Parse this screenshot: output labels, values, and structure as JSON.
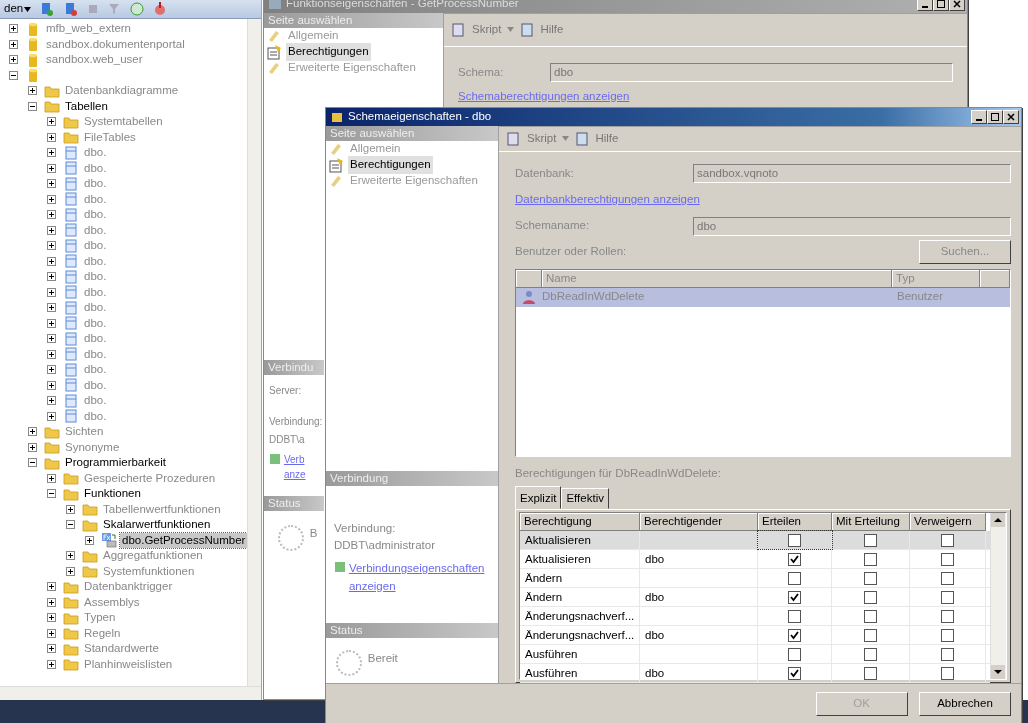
{
  "explorer": {
    "toolbar_label": "den",
    "tree": [
      {
        "kind": "database",
        "label": "mfb_web_extern",
        "expanded": false,
        "selected": false
      },
      {
        "kind": "database",
        "label": "sandbox.dokumentenportal",
        "expanded": false,
        "selected": false
      },
      {
        "kind": "database",
        "label": "sandbox.web_user",
        "expanded": false,
        "selected": false
      },
      {
        "kind": "database",
        "expanded": true,
        "selected": false,
        "children": [
          {
            "kind": "folder",
            "label": "Datenbankdiagramme",
            "expanded": false,
            "selected": false
          },
          {
            "kind": "folder",
            "label": "Tabellen",
            "expanded": true,
            "selected": false,
            "children": [
              {
                "kind": "folder",
                "label": "Systemtabellen",
                "expanded": false,
                "selected": false
              },
              {
                "kind": "folder",
                "label": "FileTables",
                "expanded": false,
                "selected": false
              },
              {
                "kind": "table",
                "label": "dbo.",
                "expanded": false,
                "selected": false
              },
              {
                "kind": "table",
                "label": "dbo.",
                "expanded": false,
                "selected": false
              },
              {
                "kind": "table",
                "label": "dbo.",
                "expanded": false,
                "selected": false
              },
              {
                "kind": "table",
                "label": "dbo.",
                "expanded": false,
                "selected": false
              },
              {
                "kind": "table",
                "label": "dbo.",
                "expanded": false,
                "selected": false
              },
              {
                "kind": "table",
                "label": "dbo.",
                "expanded": false,
                "selected": false
              },
              {
                "kind": "table",
                "label": "dbo.",
                "expanded": false,
                "selected": false
              },
              {
                "kind": "table",
                "label": "dbo.",
                "expanded": false,
                "selected": false
              },
              {
                "kind": "table",
                "label": "dbo.",
                "expanded": false,
                "selected": false
              },
              {
                "kind": "table",
                "label": "dbo.",
                "expanded": false,
                "selected": false
              },
              {
                "kind": "table",
                "label": "dbo.",
                "expanded": false,
                "selected": false
              },
              {
                "kind": "table",
                "label": "dbo.",
                "expanded": false,
                "selected": false
              },
              {
                "kind": "table",
                "label": "dbo.",
                "expanded": false,
                "selected": false
              },
              {
                "kind": "table",
                "label": "dbo.",
                "expanded": false,
                "selected": false
              },
              {
                "kind": "table",
                "label": "dbo.",
                "expanded": false,
                "selected": false
              },
              {
                "kind": "table",
                "label": "dbo.",
                "expanded": false,
                "selected": false
              },
              {
                "kind": "table",
                "label": "dbo.",
                "expanded": false,
                "selected": false
              },
              {
                "kind": "table",
                "label": "dbo.",
                "expanded": false,
                "selected": false
              }
            ]
          },
          {
            "kind": "folder",
            "label": "Sichten",
            "expanded": false,
            "selected": false
          },
          {
            "kind": "folder",
            "label": "Synonyme",
            "expanded": false,
            "selected": false
          },
          {
            "kind": "folder",
            "label": "Programmierbarkeit",
            "expanded": true,
            "selected": false,
            "children": [
              {
                "kind": "folder",
                "label": "Gespeicherte Prozeduren",
                "expanded": false,
                "selected": false
              },
              {
                "kind": "folder",
                "label": "Funktionen",
                "expanded": true,
                "selected": false,
                "children": [
                  {
                    "kind": "folder",
                    "label": "Tabellenwertfunktionen",
                    "expanded": false,
                    "selected": false
                  },
                  {
                    "kind": "folder",
                    "label": "Skalarwertfunktionen",
                    "expanded": true,
                    "selected": false,
                    "children": [
                      {
                        "kind": "function",
                        "label": "dbo.GetProcessNumber",
                        "expanded": false,
                        "selected": true
                      }
                    ]
                  },
                  {
                    "kind": "folder",
                    "label": "Aggregatfunktionen",
                    "expanded": false,
                    "selected": false
                  },
                  {
                    "kind": "folder",
                    "label": "Systemfunktionen",
                    "expanded": false,
                    "selected": false
                  }
                ]
              },
              {
                "kind": "folder",
                "label": "Datenbanktrigger",
                "expanded": false,
                "selected": false
              },
              {
                "kind": "folder",
                "label": "Assemblys",
                "expanded": false,
                "selected": false
              },
              {
                "kind": "folder",
                "label": "Typen",
                "expanded": false,
                "selected": false
              },
              {
                "kind": "folder",
                "label": "Regeln",
                "expanded": false,
                "selected": false
              },
              {
                "kind": "folder",
                "label": "Standardwerte",
                "expanded": false,
                "selected": false
              },
              {
                "kind": "folder",
                "label": "Planhinweislisten",
                "expanded": false,
                "selected": false
              }
            ]
          }
        ]
      }
    ]
  },
  "back_dialog": {
    "title": "Funktionseigenschaften - GetProcessNumber",
    "pages_header": "Seite auswählen",
    "pages": [
      {
        "label": "Allgemein",
        "selected": false
      },
      {
        "label": "Berechtigungen",
        "selected": true
      },
      {
        "label": "Erweiterte Eigenschaften",
        "selected": false
      }
    ],
    "script": "Skript",
    "help": "Hilfe",
    "schema_label": "Schema:",
    "schema_value": "dbo",
    "schema_link": "Schemaberechtigungen anzeigen",
    "connection_header": "Verbindu",
    "server_label": "Server:",
    "connection_label": "Verbindung:",
    "connection_value": "DDBT\\a",
    "connection_link_lines": [
      "Verb",
      "anze"
    ],
    "status_header": "Status",
    "status_text": "B"
  },
  "front_dialog": {
    "title": "Schemaeigenschaften - dbo",
    "pages_header": "Seite auswählen",
    "pages": [
      {
        "label": "Allgemein",
        "selected": false
      },
      {
        "label": "Berechtigungen",
        "selected": true
      },
      {
        "label": "Erweiterte Eigenschaften",
        "selected": false
      }
    ],
    "script": "Skript",
    "help": "Hilfe",
    "database_label": "Datenbank:",
    "database_value": "sandbox.vqnoto",
    "database_link": "Datenbankberechtigungen anzeigen",
    "schema_name_label": "Schemaname:",
    "schema_name_value": "dbo",
    "users_label": "Benutzer oder Rollen:",
    "search_button": "Suchen...",
    "users_columns": [
      "Name",
      "Typ"
    ],
    "users": [
      {
        "name": "DbReadInWdDelete",
        "type": "Benutzer",
        "selected": true
      }
    ],
    "permissions_label": "Berechtigungen für DbReadInWdDelete:",
    "tabs": [
      {
        "label": "Explizit",
        "selected": true
      },
      {
        "label": "Effektiv",
        "selected": false
      }
    ],
    "permission_columns": [
      "Berechtigung",
      "Berechtigender",
      "Erteilen",
      "Mit Erteilung",
      "Verweigern"
    ],
    "permissions": [
      {
        "permission": "Aktualisieren",
        "selected": true,
        "grant": false,
        "with_grant": false,
        "deny": false
      },
      {
        "permission": "Aktualisieren",
        "grantor": "dbo",
        "selected": false,
        "grant": true,
        "with_grant": false,
        "deny": false
      },
      {
        "permission": "Ändern",
        "selected": false,
        "grant": false,
        "with_grant": false,
        "deny": false
      },
      {
        "permission": "Ändern",
        "grantor": "dbo",
        "selected": false,
        "grant": true,
        "with_grant": false,
        "deny": false
      },
      {
        "permission": "Änderungsnachverf...",
        "selected": false,
        "grant": false,
        "with_grant": false,
        "deny": false
      },
      {
        "permission": "Änderungsnachverf...",
        "grantor": "dbo",
        "selected": false,
        "grant": true,
        "with_grant": false,
        "deny": false
      },
      {
        "permission": "Ausführen",
        "selected": false,
        "grant": false,
        "with_grant": false,
        "deny": false
      },
      {
        "permission": "Ausführen",
        "grantor": "dbo",
        "selected": false,
        "grant": true,
        "with_grant": false,
        "deny": false
      }
    ],
    "connection_header": "Verbindung",
    "connection_label": "Verbindung:",
    "connection_value": "DDBT\\administrator",
    "connection_link": "Verbindungseigenschaften anzeigen",
    "status_header": "Status",
    "status_text": "Bereit",
    "buttons": [
      {
        "label": "OK",
        "disabled": true
      },
      {
        "label": "Abbrechen",
        "disabled": false
      }
    ]
  }
}
